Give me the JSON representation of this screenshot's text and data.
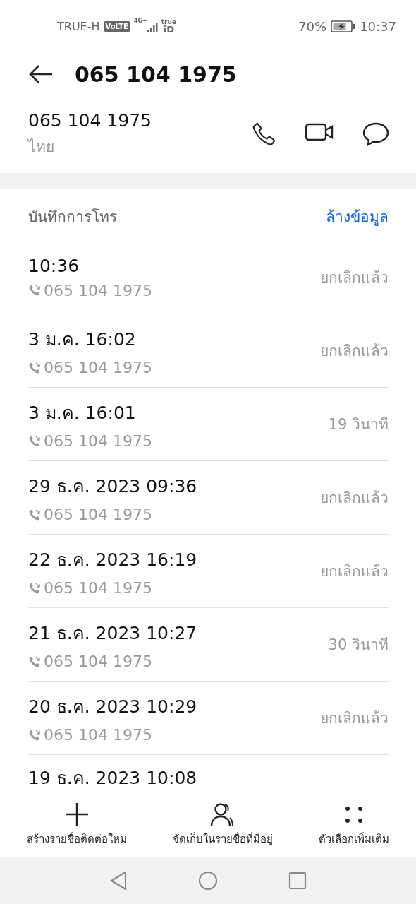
{
  "status_bar": {
    "carrier": "TRUE-H",
    "volte": "VoLTE",
    "network": "4G+",
    "logo_top": "true",
    "logo_bottom": "iD",
    "battery": "70%",
    "time": "10:37"
  },
  "header": {
    "title": "065 104 1975"
  },
  "contact": {
    "number": "065 104 1975",
    "location": "ไทย"
  },
  "call_log": {
    "title": "บันทึกการโทร",
    "clear": "ล้างข้อมูล",
    "entries": [
      {
        "time": "10:36",
        "number": "065 104 1975",
        "status": "ยกเลิกแล้ว"
      },
      {
        "time": "3 ม.ค. 16:02",
        "number": "065 104 1975",
        "status": "ยกเลิกแล้ว"
      },
      {
        "time": "3 ม.ค. 16:01",
        "number": "065 104 1975",
        "status": "19 วินาที"
      },
      {
        "time": "29 ธ.ค. 2023 09:36",
        "number": "065 104 1975",
        "status": "ยกเลิกแล้ว"
      },
      {
        "time": "22 ธ.ค. 2023 16:19",
        "number": "065 104 1975",
        "status": "ยกเลิกแล้ว"
      },
      {
        "time": "21 ธ.ค. 2023 10:27",
        "number": "065 104 1975",
        "status": "30 วินาที"
      },
      {
        "time": "20 ธ.ค. 2023 10:29",
        "number": "065 104 1975",
        "status": "ยกเลิกแล้ว"
      },
      {
        "time": "19 ธ.ค. 2023 10:08"
      }
    ]
  },
  "toolbar": [
    {
      "kind": "add",
      "label": "สร้างรายชื่อติดต่อใหม่"
    },
    {
      "kind": "contacts",
      "label": "จัดเก็บในรายชื่อที่มีอยู่"
    },
    {
      "kind": "more",
      "label": "ตัวเลือกเพิ่มเติม"
    }
  ]
}
